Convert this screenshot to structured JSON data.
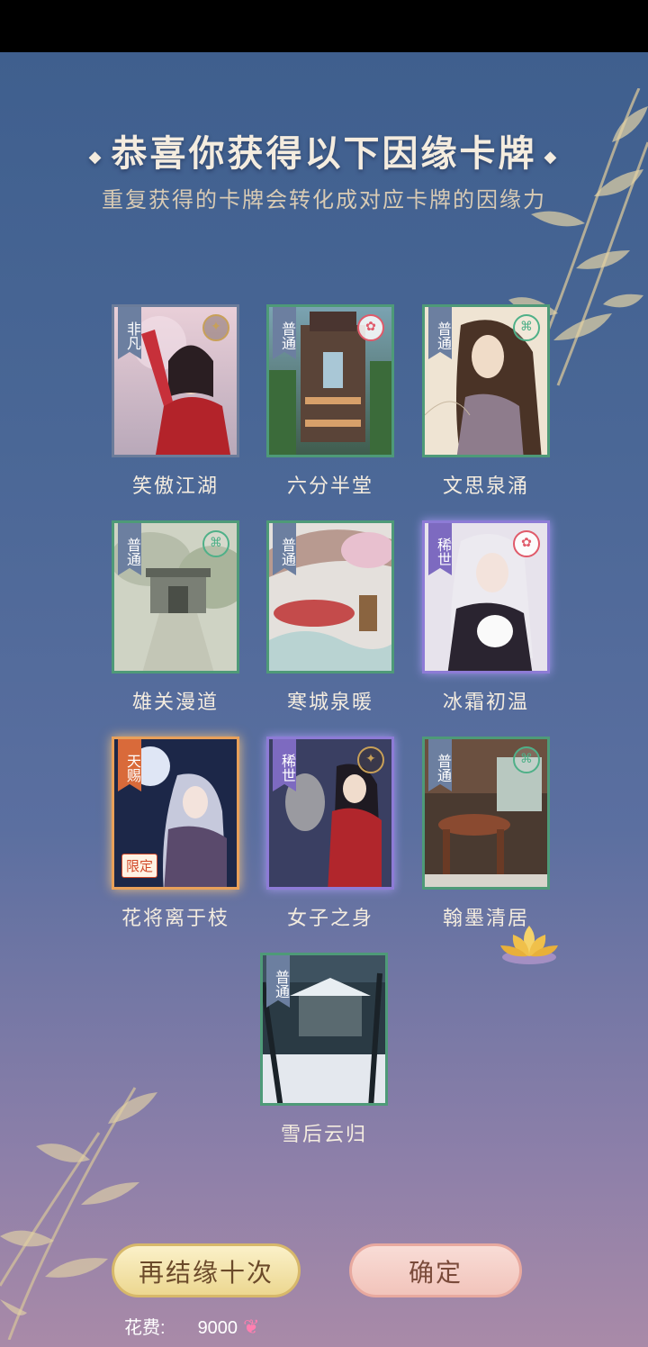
{
  "title": "恭喜你获得以下因缘卡牌",
  "subtitle": "重复获得的卡牌会转化成对应卡牌的因缘力",
  "cards": [
    {
      "name": "笑傲江湖",
      "rarity": "非凡"
    },
    {
      "name": "六分半堂",
      "rarity": "普通"
    },
    {
      "name": "文思泉涌",
      "rarity": "普通"
    },
    {
      "name": "雄关漫道",
      "rarity": "普通"
    },
    {
      "name": "寒城泉暖",
      "rarity": "普通"
    },
    {
      "name": "冰霜初温",
      "rarity": "稀世"
    },
    {
      "name": "花将离于枝",
      "rarity": "天赐",
      "limited": "限定"
    },
    {
      "name": "女子之身",
      "rarity": "稀世"
    },
    {
      "name": "翰墨清居",
      "rarity": "普通"
    },
    {
      "name": "雪后云归",
      "rarity": "普通"
    }
  ],
  "buttons": {
    "again": "再结缘十次",
    "confirm": "确定"
  },
  "cost": {
    "label": "花费:",
    "value": "9000"
  },
  "colors": {
    "common_border": "#4e9a78",
    "rare_border": "#8d7bd6",
    "heaven_border": "#e8a05a",
    "title_text": "#f4ecdf"
  }
}
